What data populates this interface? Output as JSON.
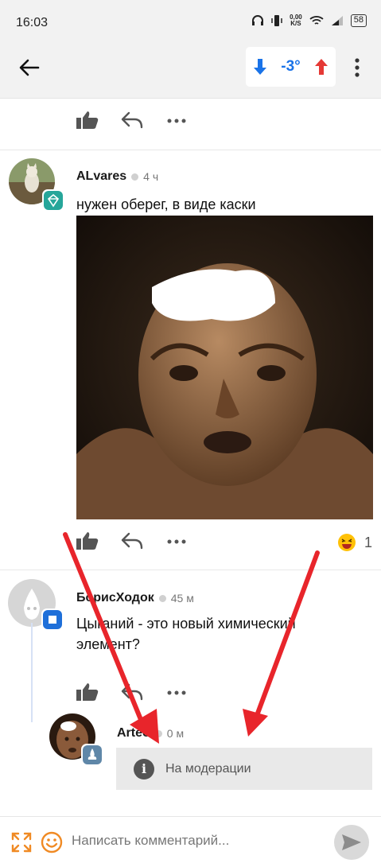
{
  "status_bar": {
    "time": "16:03",
    "net_speed_value": "0,00",
    "net_speed_unit": "K/S",
    "battery": "58"
  },
  "app_bar": {
    "rating_value": "-3°",
    "icons": [
      "back-arrow-icon",
      "thumb-down-arrow-icon",
      "thumb-up-arrow-icon",
      "more-vertical-icon"
    ],
    "colors": {
      "down": "#1a73e8",
      "up": "#e53935"
    }
  },
  "comments": [
    {
      "author": "ALvares",
      "time_ago": "4 ч",
      "text": "нужен оберег, в виде каски",
      "has_image": true,
      "reaction_count": "1"
    },
    {
      "author": "БорисХодок",
      "time_ago": "45 м",
      "text_line1": "Цыганий - это новый химический",
      "text_line2": "элемент?"
    },
    {
      "author": "Arteo",
      "time_ago": "0 м",
      "moderation_label": "На модерации"
    }
  ],
  "input_bar": {
    "placeholder": "Написать комментарий..."
  },
  "annotation": {
    "arrow_color": "#e8252b"
  }
}
